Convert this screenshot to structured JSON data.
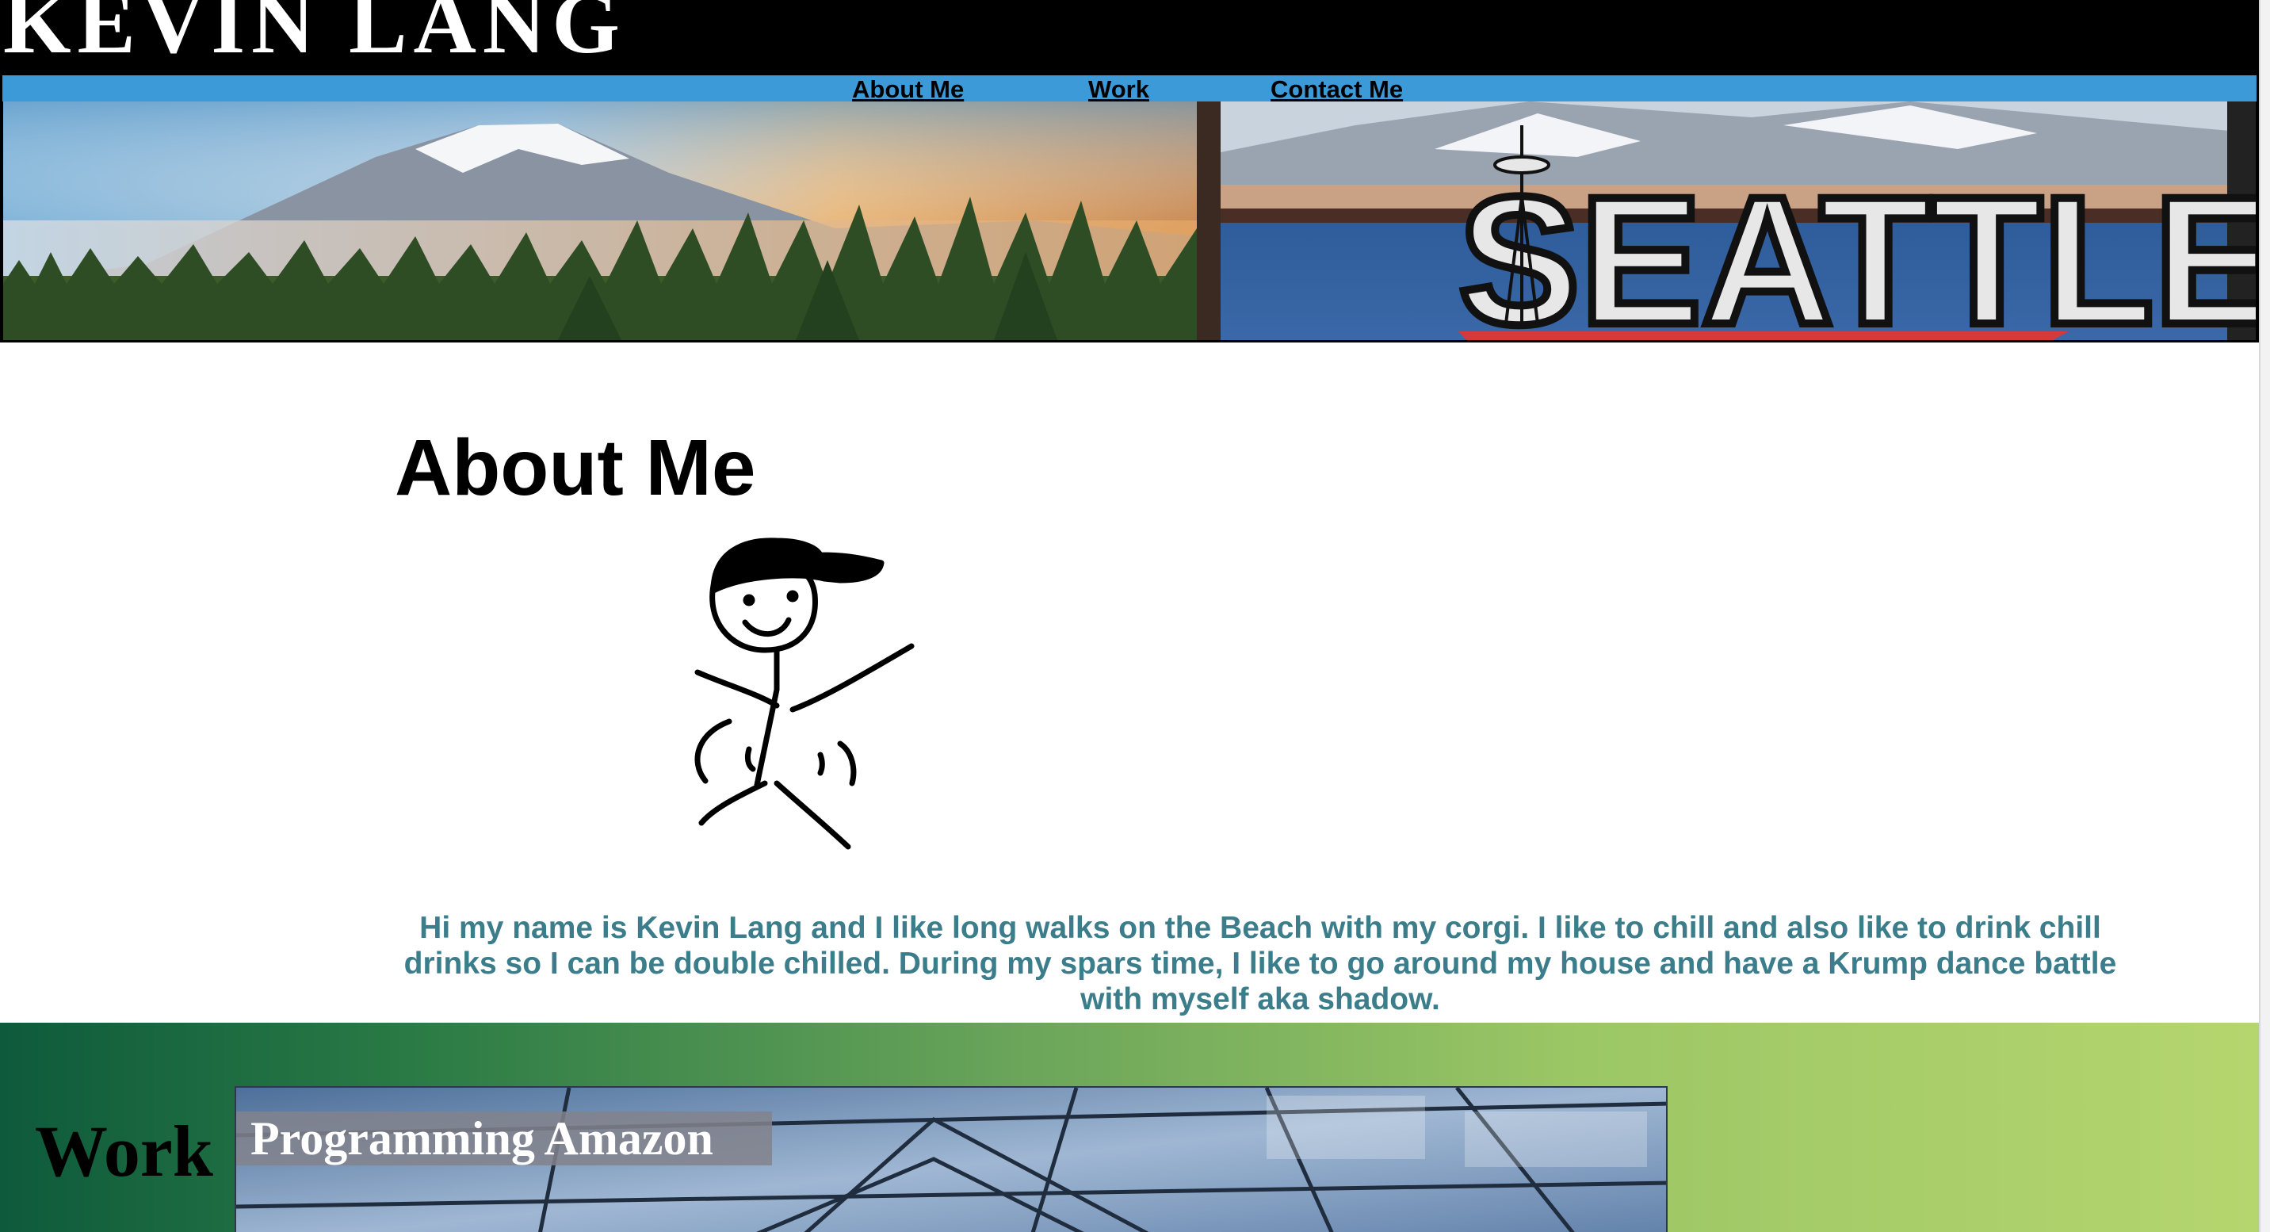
{
  "header": {
    "site_title": "KEVIN LANG"
  },
  "nav": {
    "items": [
      {
        "label": "About Me"
      },
      {
        "label": "Work"
      },
      {
        "label": "Contact Me"
      }
    ],
    "background_color": "#3d9ad8"
  },
  "banner": {
    "left_image": "mountain-forest-landscape",
    "right_image": "seattle-postcard-mural"
  },
  "about": {
    "heading": "About Me",
    "avatar": "stick-figure-with-cap",
    "bio": "Hi my name is Kevin Lang and I like long walks on the Beach with my corgi. I like to chill and also like to drink chill drinks so I can be double chilled. During my spars time, I like to go around my house and have a Krump dance battle with myself aka shadow.",
    "bio_color": "#3b7d8b"
  },
  "work": {
    "heading": "Work",
    "projects": [
      {
        "title": "Programming Amazon",
        "image": "glass-building-facade"
      }
    ]
  }
}
